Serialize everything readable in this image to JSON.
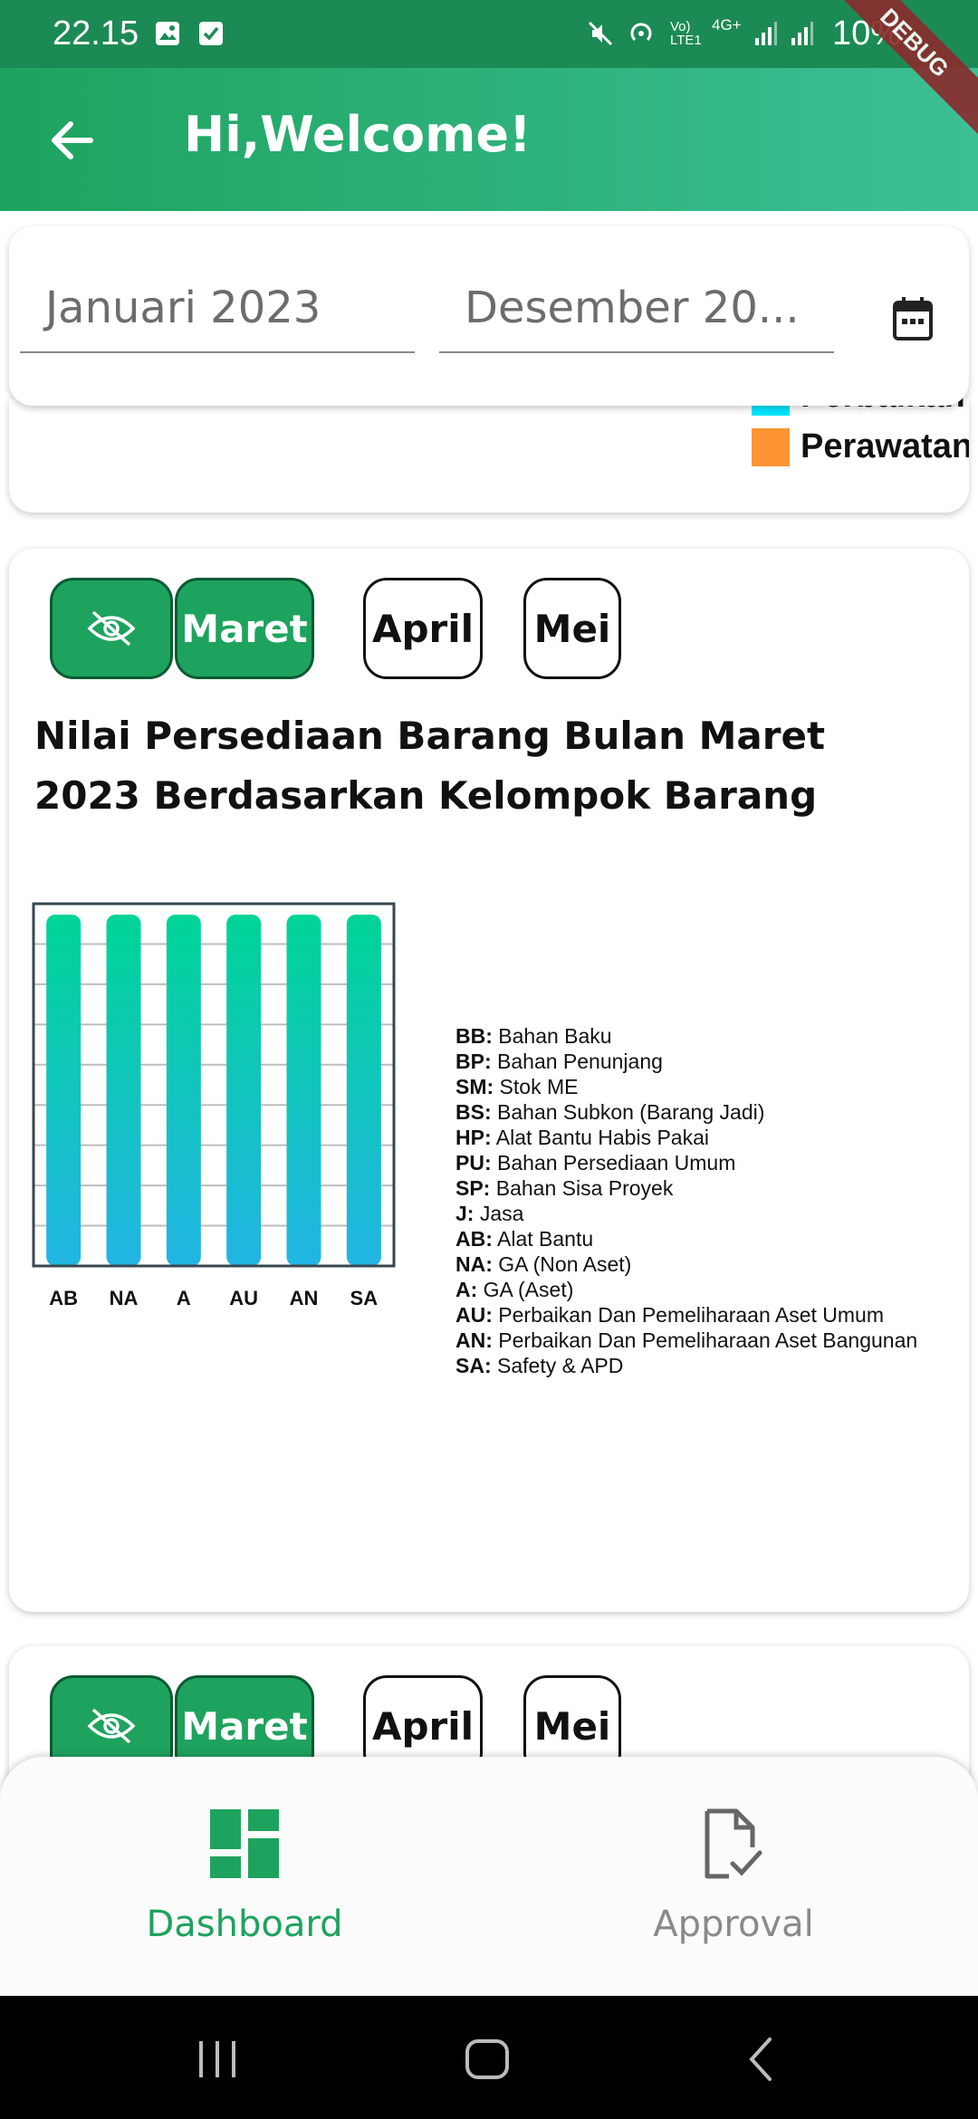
{
  "status_bar": {
    "time": "22.15",
    "battery": "10%",
    "network": "4G+",
    "debug_banner": "DEBUG"
  },
  "app_bar": {
    "title": "Hi,Welcome!",
    "back_icon": "arrow-left-icon"
  },
  "date_filter": {
    "from": "Januari 2023",
    "to": "Desember 20...",
    "calendar_icon": "calendar-icon"
  },
  "previous_card": {
    "legend": [
      {
        "label": "Perbaikan",
        "color": "#00e5ff"
      },
      {
        "label": "Perawatan",
        "color": "#ff9433"
      }
    ]
  },
  "chart_card": {
    "toggle_icon": "eye-off-icon",
    "months": [
      "Maret",
      "April",
      "Mei"
    ],
    "active_month": "Maret",
    "title": "Nilai Persediaan Barang Bulan Maret 2023 Berdasarkan Kelompok Barang",
    "abbreviations": [
      {
        "code": "BB:",
        "label": "Bahan Baku"
      },
      {
        "code": "BP:",
        "label": "Bahan Penunjang"
      },
      {
        "code": "SM:",
        "label": "Stok ME"
      },
      {
        "code": "BS:",
        "label": "Bahan Subkon (Barang Jadi)"
      },
      {
        "code": "HP:",
        "label": "Alat Bantu Habis Pakai"
      },
      {
        "code": "PU:",
        "label": "Bahan Persediaan Umum"
      },
      {
        "code": "SP:",
        "label": "Bahan Sisa Proyek"
      },
      {
        "code": "J:",
        "label": "Jasa"
      },
      {
        "code": "AB:",
        "label": "Alat Bantu"
      },
      {
        "code": "NA:",
        "label": "GA (Non Aset)"
      },
      {
        "code": "A:",
        "label": "GA (Aset)"
      },
      {
        "code": "AU:",
        "label": "Perbaikan Dan Pemeliharaan Aset Umum"
      },
      {
        "code": "AN:",
        "label": "Perbaikan Dan Pemeliharaan Aset Bangunan"
      },
      {
        "code": "SA:",
        "label": "Safety & APD"
      }
    ]
  },
  "chart_data": {
    "type": "bar",
    "title": "",
    "categories": [
      "AB",
      "NA",
      "A",
      "AU",
      "AN",
      "SA"
    ],
    "values": [
      0.97,
      0.97,
      0.97,
      0.97,
      0.97,
      0.97
    ],
    "ylim": [
      0,
      1
    ],
    "grid": true,
    "bar_gradient": [
      "#00d496",
      "#22b5e4"
    ]
  },
  "next_card": {
    "months": [
      "Maret",
      "April",
      "Mei"
    ],
    "active_month": "Maret"
  },
  "bottom_nav": {
    "items": [
      {
        "label": "Dashboard",
        "icon": "dashboard-icon",
        "active": true
      },
      {
        "label": "Approval",
        "icon": "document-check-icon",
        "active": false
      }
    ]
  }
}
